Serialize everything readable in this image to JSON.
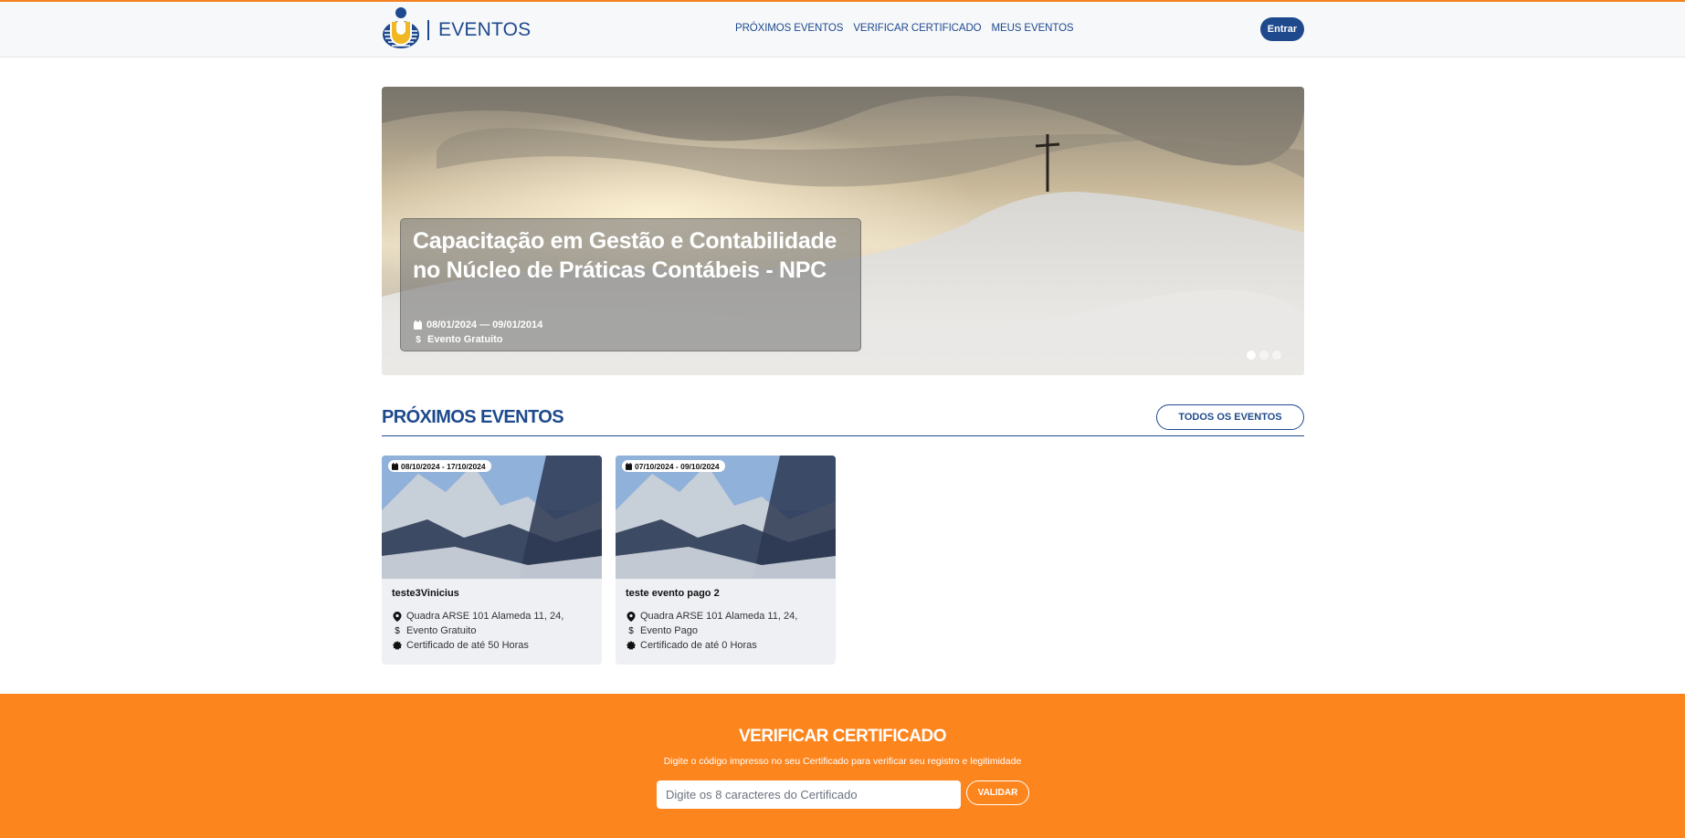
{
  "header": {
    "brand": "EVENTOS",
    "nav": [
      "PRÓXIMOS EVENTOS",
      "VERIFICAR CERTIFICADO",
      "MEUS EVENTOS"
    ],
    "login_label": "Entrar"
  },
  "hero": {
    "title": "Capacitação em Gestão e Contabilidade no Núcleo de Práticas Contábeis - NPC",
    "dates": "08/01/2024 — 09/01/2014",
    "price": "Evento Gratuito",
    "slides": 3,
    "active_slide": 1
  },
  "section": {
    "title": "PRÓXIMOS EVENTOS",
    "all_button": "TODOS OS EVENTOS"
  },
  "events": [
    {
      "date": "08/10/2024 - 17/10/2024",
      "title": "teste3Vinicius",
      "address": "Quadra ARSE 101 Alameda 11, 24,",
      "price": "Evento Gratuito",
      "certificate": "Certificado de até 50 Horas"
    },
    {
      "date": "07/10/2024 - 09/10/2024",
      "title": "teste evento pago 2",
      "address": "Quadra ARSE 101 Alameda 11, 24,",
      "price": "Evento Pago",
      "certificate": "Certificado de até 0 Horas"
    }
  ],
  "verify": {
    "title": "VERIFICAR CERTIFICADO",
    "subtitle": "Digite o código impresso no seu Certificado para verificar seu registro e legitimidade",
    "placeholder": "Digite os 8 caracteres do Certificado",
    "button": "VALIDAR"
  },
  "colors": {
    "primary": "#1e4a8d",
    "accent": "#fd851e"
  }
}
